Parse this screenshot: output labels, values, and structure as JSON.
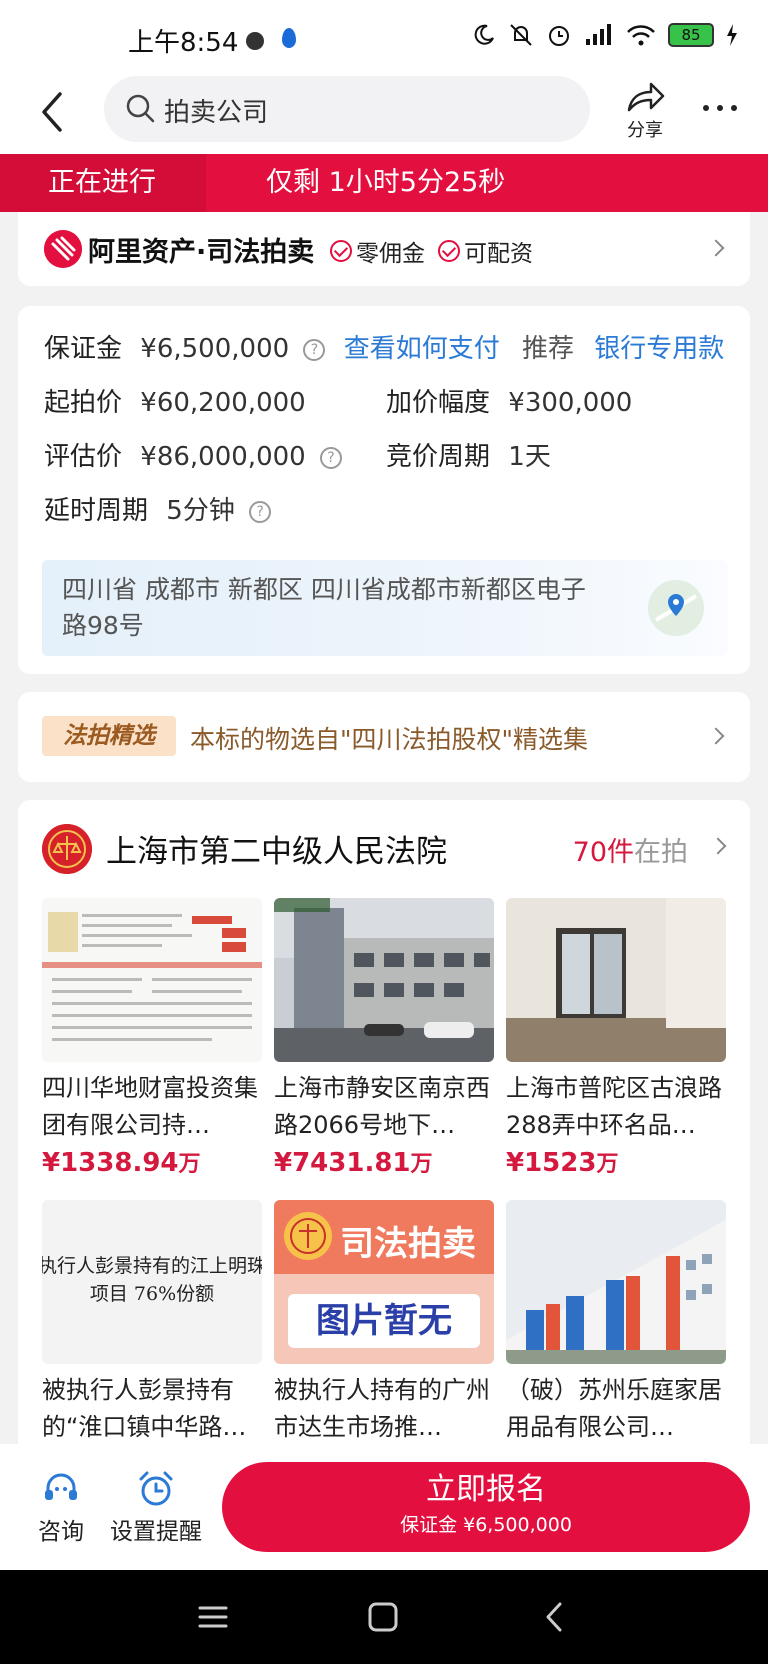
{
  "status": {
    "time": "上午8:54",
    "battery": "85"
  },
  "header": {
    "search_placeholder": "拍卖公司",
    "share_label": "分享"
  },
  "banner": {
    "status": "正在进行",
    "countdown": "仅剩 1小时5分25秒"
  },
  "platform": {
    "name": "阿里资产·司法拍卖",
    "tags": [
      "零佣金",
      "可配资"
    ]
  },
  "info": {
    "deposit_label": "保证金",
    "deposit_value": "¥6,500,000",
    "pay_link": "查看如何支付",
    "recommend_label": "推荐",
    "bank_link": "银行专用款",
    "start_label": "起拍价",
    "start_value": "¥60,200,000",
    "increment_label": "加价幅度",
    "increment_value": "¥300,000",
    "appraisal_label": "评估价",
    "appraisal_value": "¥86,000,000",
    "cycle_label": "竞价周期",
    "cycle_value": "1天",
    "delay_label": "延时周期",
    "delay_value": "5分钟",
    "address": "四川省 成都市 新都区 四川省成都市新都区电子路98号"
  },
  "selection": {
    "badge": "法拍精选",
    "text": "本标的物选自\"四川法拍股权\"精选集"
  },
  "court": {
    "name": "上海市第二中级人民法院",
    "count_num": "70件",
    "count_suffix": "在拍",
    "items": [
      {
        "title": "四川华地财富投资集团有限公司持…",
        "price": "¥1338.94",
        "unit": "万"
      },
      {
        "title": "上海市静安区南京西路2066号地下…",
        "price": "¥7431.81",
        "unit": "万"
      },
      {
        "title": "上海市普陀区古浪路288弄中环名品…",
        "price": "¥1523",
        "unit": "万"
      },
      {
        "title": "被执行人彭景持有的“淮口镇中华路…",
        "thumb_text": "执行人彭景持有的江上明珠项目 76%份额"
      },
      {
        "title": "被执行人持有的广州市达生市场推…",
        "thumb_text_top": "司法拍卖",
        "thumb_text_bottom": "图片暂无"
      },
      {
        "title": "（破）苏州乐庭家居用品有限公司…"
      }
    ]
  },
  "bottom": {
    "consult": "咨询",
    "remind": "设置提醒",
    "apply_title": "立即报名",
    "apply_sub": "保证金 ¥6,500,000"
  }
}
